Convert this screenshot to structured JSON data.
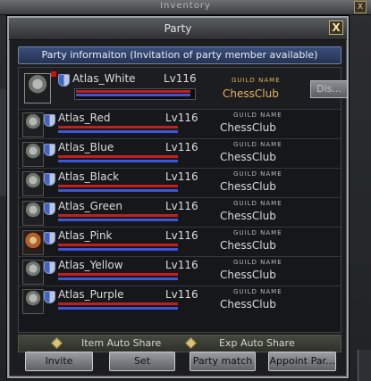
{
  "background_window": {
    "title": "Inventory",
    "close": "X"
  },
  "party_window": {
    "title": "Party",
    "close": "X"
  },
  "info_header": "Party informaiton (Invitation of party member available)",
  "leader": {
    "name": "Atlas_White",
    "level": "Lv116",
    "guild_label": "GUILD NAME",
    "guild": "ChessClub",
    "dismiss_label": "Dis..."
  },
  "members": [
    {
      "name": "Atlas_Red",
      "level": "Lv116",
      "guild_label": "GUILD NAME",
      "guild": "ChessClub",
      "avatar": "knight-helmet-icon"
    },
    {
      "name": "Atlas_Blue",
      "level": "Lv116",
      "guild_label": "GUILD NAME",
      "guild": "ChessClub",
      "avatar": "knight-helmet-icon"
    },
    {
      "name": "Atlas_Black",
      "level": "Lv116",
      "guild_label": "GUILD NAME",
      "guild": "ChessClub",
      "avatar": "knight-helmet-icon"
    },
    {
      "name": "Atlas_Green",
      "level": "Lv116",
      "guild_label": "GUILD NAME",
      "guild": "ChessClub",
      "avatar": "knight-helmet-icon"
    },
    {
      "name": "Atlas_Pink",
      "level": "Lv116",
      "guild_label": "GUILD NAME",
      "guild": "ChessClub",
      "avatar": "red-hair-warrior-icon"
    },
    {
      "name": "Atlas_Yellow",
      "level": "Lv116",
      "guild_label": "GUILD NAME",
      "guild": "ChessClub",
      "avatar": "knight-helmet-icon"
    },
    {
      "name": "Atlas_Purple",
      "level": "Lv116",
      "guild_label": "GUILD NAME",
      "guild": "ChessClub",
      "avatar": "knight-helmet-icon"
    }
  ],
  "share": {
    "item_label": "Item Auto Share",
    "exp_label": "Exp Auto Share"
  },
  "buttons": {
    "invite": "Invite",
    "set": "Set",
    "party_match": "Party match",
    "appoint": "Appoint Par..."
  },
  "colors": {
    "hp_bar": "#c31f1f",
    "mp_bar": "#3d55d6",
    "leader_text": "#e6b25e",
    "header_bg": "#3b4e7c"
  },
  "bars": {
    "hp_fill": 1.0,
    "mp_fill": 1.0
  }
}
